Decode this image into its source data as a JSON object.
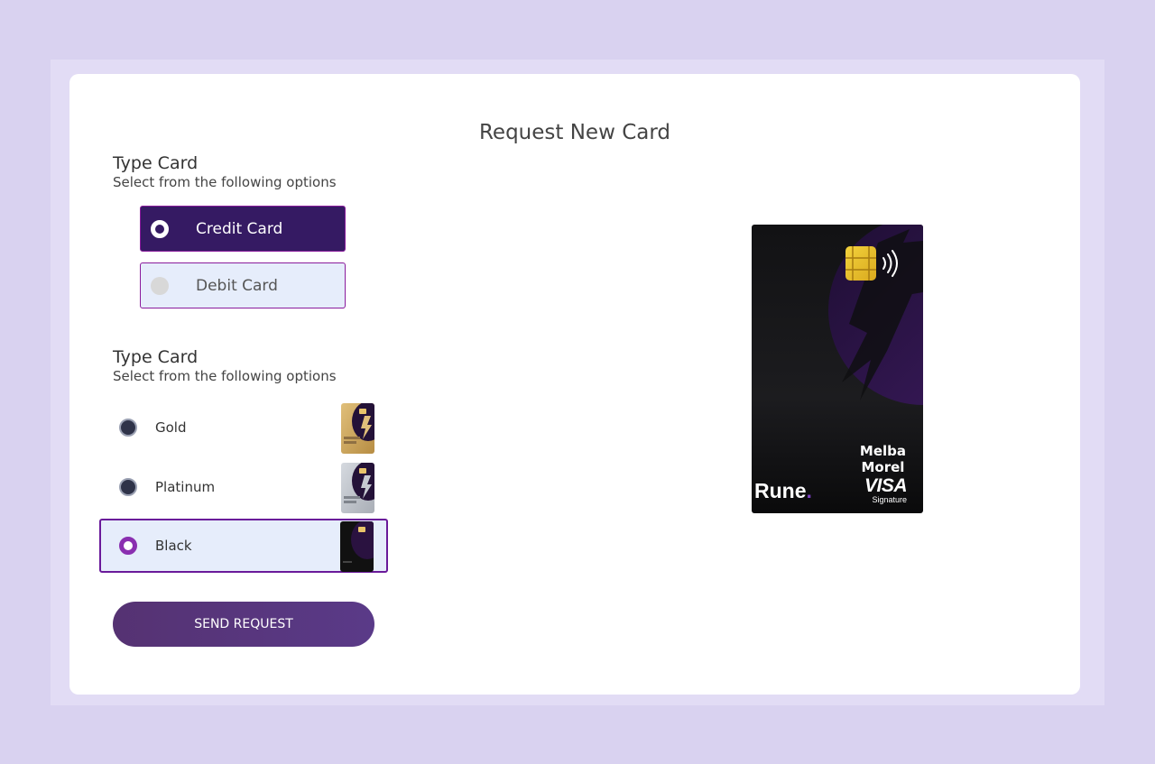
{
  "page": {
    "title": "Request New Card"
  },
  "type_section": {
    "title": "Type Card",
    "subtitle": "Select from the following options",
    "options": [
      {
        "label": "Credit Card",
        "selected": true
      },
      {
        "label": "Debit Card",
        "selected": false
      }
    ]
  },
  "tier_section": {
    "title": "Type Card",
    "subtitle": "Select from the following options",
    "options": [
      {
        "label": "Gold",
        "selected": false
      },
      {
        "label": "Platinum",
        "selected": false
      },
      {
        "label": "Black",
        "selected": true
      }
    ]
  },
  "actions": {
    "send_label": "SEND REQUEST"
  },
  "card": {
    "holder_first": "Melba",
    "holder_last": "Morel",
    "brand": "Rune",
    "brand_dot": ".",
    "network": "VISA",
    "network_tier": "Signature"
  },
  "colors": {
    "page_bg": "#d9d2f0",
    "accent": "#351a63",
    "selected_bg": "#e6edfb",
    "button": "#553272"
  }
}
